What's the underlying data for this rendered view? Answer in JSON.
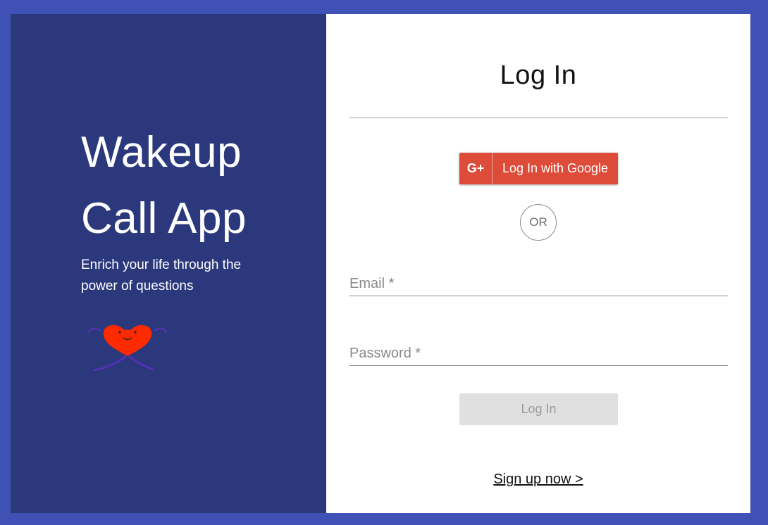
{
  "brand": {
    "title_line1": "Wakeup",
    "title_line2": "Call App",
    "tagline": "Enrich your life through the power of questions"
  },
  "login": {
    "heading": "Log In",
    "google_button_icon": "G+",
    "google_button_label": "Log In with Google",
    "or_label": "OR",
    "email_placeholder": "Email *",
    "password_placeholder": "Password *",
    "submit_label": "Log In",
    "signup_link": "Sign up now >"
  },
  "colors": {
    "outer_background": "#3f51b5",
    "left_panel": "#2b387c",
    "google_red": "#dd4b39",
    "mascot_heart": "#ff2a00",
    "mascot_ribbon": "#5a2fc0"
  },
  "icons": {
    "google": "google-plus-icon",
    "mascot": "heart-mascot-icon"
  }
}
